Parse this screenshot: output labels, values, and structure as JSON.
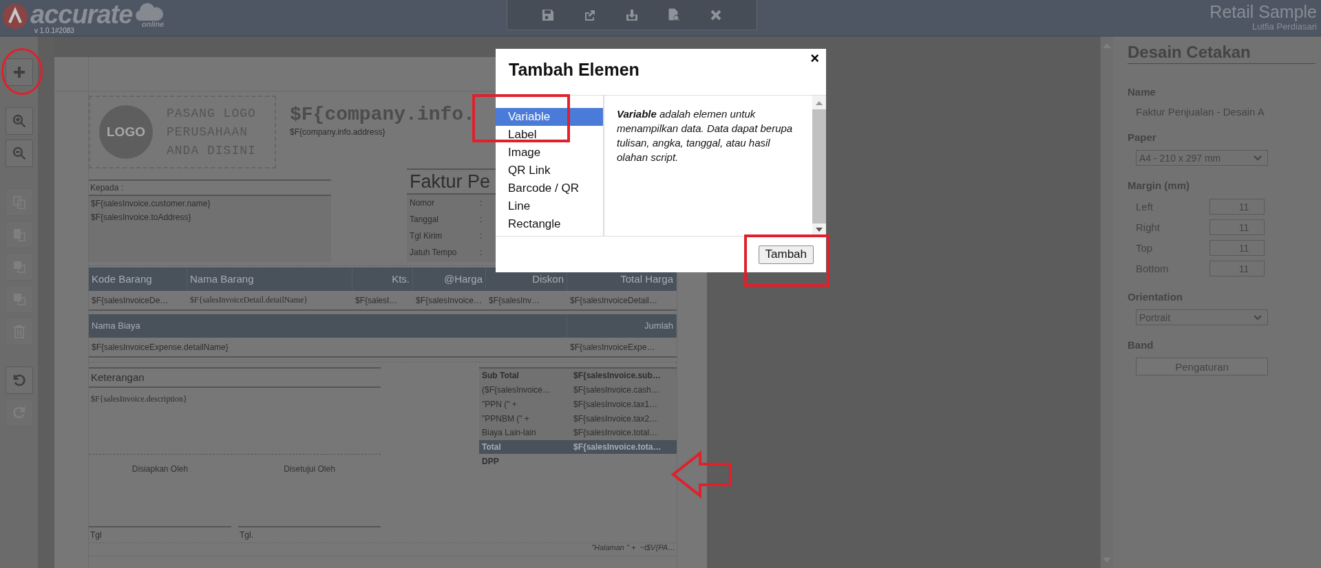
{
  "app": {
    "logo_text": "accurate",
    "logo_sub": "online",
    "version": "v 1.0.1#2083",
    "company": "Retail Sample",
    "user": "Lutfia Perdiasari"
  },
  "tools": [
    {
      "kind": "add",
      "disabled": false
    },
    {
      "kind": "zoom_in",
      "disabled": false
    },
    {
      "kind": "zoom_out",
      "disabled": false
    },
    {
      "kind": "copy",
      "disabled": true
    },
    {
      "kind": "paste",
      "disabled": true
    },
    {
      "kind": "layer",
      "disabled": true
    },
    {
      "kind": "layer",
      "disabled": true
    },
    {
      "kind": "delete",
      "disabled": true
    },
    {
      "kind": "undo",
      "disabled": false
    },
    {
      "kind": "redo",
      "disabled": true
    }
  ],
  "document": {
    "logo_badge": "LOGO",
    "logo_prompt": "PASANG LOGO PERUSAHAAN ANDA DISINI",
    "company_name": "$F{company.info.",
    "company_address": "$F{company.info.address}",
    "recipient": {
      "label": "Kepada :",
      "lines": [
        "$F{salesInvoice.customer.name}",
        "$F{salesInvoice.toAddress}"
      ]
    },
    "invoice_title": "Faktur Pe",
    "invoice_fields": [
      {
        "label": "Nomor",
        "separator": ":"
      },
      {
        "label": "Tanggal",
        "separator": ":"
      },
      {
        "label": "Tgl Kirim",
        "separator": ":"
      },
      {
        "label": "Jatuh Tempo",
        "separator": ":"
      }
    ],
    "items_table": {
      "columns": [
        "Kode Barang",
        "Nama Barang",
        "Kts.",
        "@Harga",
        "Diskon",
        "Total Harga"
      ],
      "row": [
        "$F{salesInvoiceDe…",
        "$F{salesInvoiceDetail.detailName}",
        "$F{salesI…",
        "$F{salesInvoice…",
        "$F{salesInv…",
        "$F{salesInvoiceDetail…"
      ]
    },
    "expense_table": {
      "columns": [
        "Nama Biaya",
        "Jumlah"
      ],
      "row": [
        "$F{salesInvoiceExpense.detailName}",
        "$F{salesInvoiceExpe…"
      ]
    },
    "notes": {
      "label": "Keterangan",
      "value": "$F{salesInvoice.description}"
    },
    "signatures": [
      {
        "title": "Disiapkan Oleh",
        "date_label": "Tgl"
      },
      {
        "title": "Disetujui Oleh",
        "date_label": "Tgl."
      }
    ],
    "totals": [
      {
        "kind": "bold",
        "label": "Sub Total",
        "value": "$F{salesInvoice.sub…"
      },
      {
        "kind": "plain",
        "label": "($F{salesInvoice…",
        "value": "$F{salesInvoice.cash…"
      },
      {
        "kind": "plain",
        "label": "\"PPN (\" +",
        "value": "$F{salesInvoice.tax1…"
      },
      {
        "kind": "plain",
        "label": "\"PPNBM (\" +",
        "value": "$F{salesInvoice.tax2…"
      },
      {
        "kind": "plain",
        "label": "Biaya Lain-lain",
        "value": "$F{salesInvoice.total…"
      },
      {
        "kind": "highlight",
        "label": "Total",
        "value": "$F{salesInvoice.tota…"
      },
      {
        "kind": "bold",
        "label": "DPP"
      }
    ],
    "footer": "\"Halaman \" +  ~t$V{PA…"
  },
  "dialog": {
    "title": "Tambah Elemen",
    "close": "×",
    "items": [
      {
        "label": "Variable",
        "selected": true
      },
      {
        "label": "Label",
        "selected": false
      },
      {
        "label": "Image",
        "selected": false
      },
      {
        "label": "QR Link",
        "selected": false
      },
      {
        "label": "Barcode / QR",
        "selected": false
      },
      {
        "label": "Line",
        "selected": false
      },
      {
        "label": "Rectangle",
        "selected": false
      }
    ],
    "description": "**Variable** adalah elemen untuk menampilkan data. Data dapat berupa tulisan, angka, tanggal, atau hasil olahan script.",
    "button": "Tambah"
  },
  "properties": {
    "title": "Desain Cetakan",
    "name_label": "Name",
    "name_value": "Faktur Penjualan - Desain A",
    "paper_label": "Paper",
    "paper_value": "A4 - 210 x 297 mm",
    "margin_label": "Margin (mm)",
    "margins": [
      {
        "label": "Left",
        "value": "11"
      },
      {
        "label": "Right",
        "value": "11"
      },
      {
        "label": "Top",
        "value": "11"
      },
      {
        "label": "Bottom",
        "value": "11"
      }
    ],
    "orientation_label": "Orientation",
    "orientation_value": "Portrait",
    "band_label": "Band",
    "band_button": "Pengaturan"
  }
}
